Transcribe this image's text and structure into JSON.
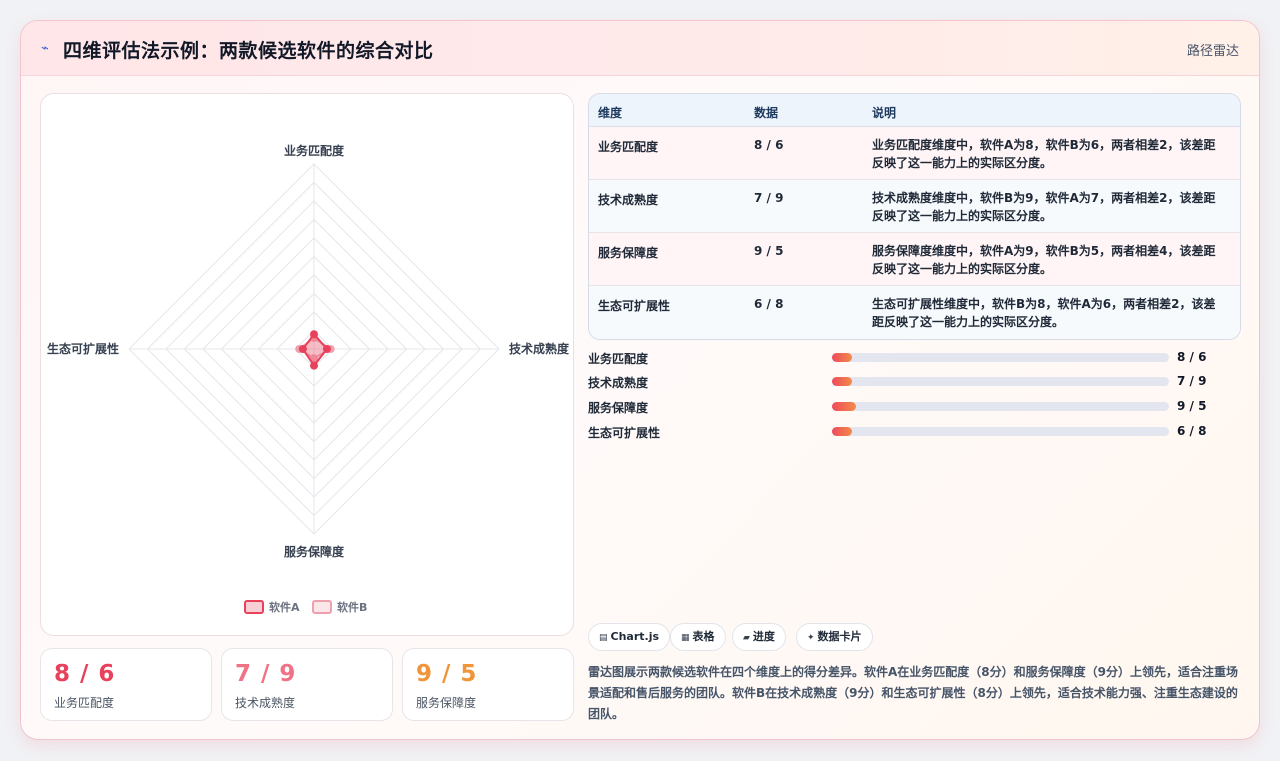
{
  "header": {
    "title": "四维评估法示例：两款候选软件的综合对比",
    "tag": "路径雷达",
    "icon": "chart-line-icon"
  },
  "chart_data": {
    "type": "radar",
    "axes": [
      "业务匹配度",
      "技术成熟度",
      "服务保障度",
      "生态可扩展性"
    ],
    "r_max": 100,
    "series": [
      {
        "name": "软件A",
        "values": [
          8,
          7,
          9,
          6
        ],
        "color": "#e8415c"
      },
      {
        "name": "软件B",
        "values": [
          6,
          9,
          5,
          8
        ],
        "color": "#f0a0ad"
      }
    ],
    "legend": "bottom"
  },
  "stats": [
    {
      "value": "8 / 6",
      "label": "业务匹配度",
      "color": "#e8415c"
    },
    {
      "value": "7 / 9",
      "label": "技术成熟度",
      "color": "#f07287"
    },
    {
      "value": "9 / 5",
      "label": "服务保障度",
      "color": "#f0953a"
    }
  ],
  "table": {
    "headers": [
      "维度",
      "数据",
      "说明"
    ],
    "rows": [
      {
        "dim": "业务匹配度",
        "data": "8 / 6",
        "note": "业务匹配度维度中，软件A为8，软件B为6，两者相差2，该差距反映了这一能力上的实际区分度。"
      },
      {
        "dim": "技术成熟度",
        "data": "7 / 9",
        "note": "技术成熟度维度中，软件B为9，软件A为7，两者相差2，该差距反映了这一能力上的实际区分度。"
      },
      {
        "dim": "服务保障度",
        "data": "9 / 5",
        "note": "服务保障度维度中，软件A为9，软件B为5，两者相差4，该差距反映了这一能力上的实际区分度。"
      },
      {
        "dim": "生态可扩展性",
        "data": "6 / 8",
        "note": "生态可扩展性维度中，软件B为8，软件A为6，两者相差2，该差距反映了这一能力上的实际区分度。"
      }
    ]
  },
  "bars": [
    {
      "label": "业务匹配度",
      "value": "8 / 6",
      "fill": 0.06
    },
    {
      "label": "技术成熟度",
      "value": "7 / 9",
      "fill": 0.06
    },
    {
      "label": "服务保障度",
      "value": "9 / 5",
      "fill": 0.07
    },
    {
      "label": "生态可扩展性",
      "value": "6 / 8",
      "fill": 0.06
    }
  ],
  "chips": [
    {
      "icon": "chart-icon",
      "glyph": "▤",
      "label": "Chart.js"
    },
    {
      "icon": "table-icon",
      "glyph": "▦",
      "label": "表格"
    },
    {
      "icon": "progress-icon",
      "glyph": "▰",
      "label": "进度"
    },
    {
      "icon": "card-icon",
      "glyph": "✦",
      "label": "数据卡片"
    }
  ],
  "description": "雷达图展示两款候选软件在四个维度上的得分差异。软件A在业务匹配度（8分）和服务保障度（9分）上领先，适合注重场景适配和售后服务的团队。软件B在技术成熟度（9分）和生态可扩展性（8分）上领先，适合技术能力强、注重生态建设的团队。"
}
